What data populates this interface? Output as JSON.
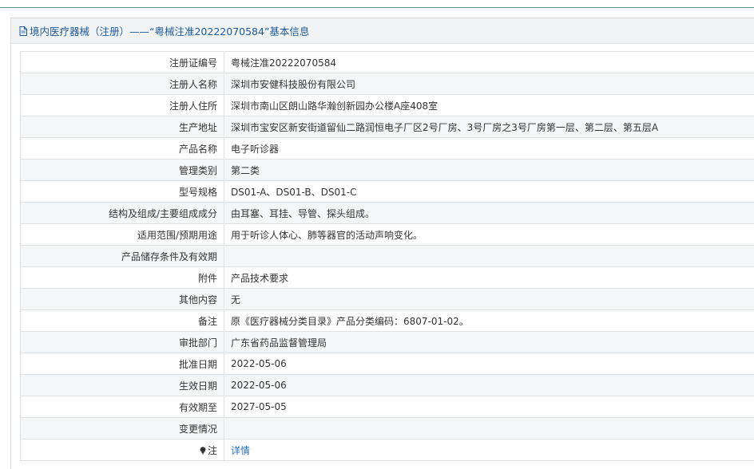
{
  "header": {
    "title": "境内医疗器械（注册）——“粤械注准20222070584”基本信息",
    "icon": "document-icon"
  },
  "rows": [
    {
      "label": "注册证编号",
      "value": "粤械注准20222070584"
    },
    {
      "label": "注册人名称",
      "value": "深圳市安健科技股份有限公司"
    },
    {
      "label": "注册人住所",
      "value": "深圳市南山区朗山路华瀚创新园办公楼A座408室"
    },
    {
      "label": "生产地址",
      "value": "深圳市宝安区新安街道留仙二路润恒电子厂区2号厂房、3号厂房之3号厂房第一层、第二层、第五层A"
    },
    {
      "label": "产品名称",
      "value": "电子听诊器"
    },
    {
      "label": "管理类别",
      "value": "第二类"
    },
    {
      "label": "型号规格",
      "value": "DS01-A、DS01-B、DS01-C"
    },
    {
      "label": "结构及组成/主要组成成分",
      "value": "由耳塞、耳挂、导管、探头组成。"
    },
    {
      "label": "适用范围/预期用途",
      "value": "用于听诊人体心、肺等器官的活动声响变化。"
    },
    {
      "label": "产品储存条件及有效期",
      "value": ""
    },
    {
      "label": "附件",
      "value": "产品技术要求"
    },
    {
      "label": "其他内容",
      "value": "无"
    },
    {
      "label": "备注",
      "value": "原《医疗器械分类目录》产品分类编码：6807-01-02。"
    },
    {
      "label": "审批部门",
      "value": "广东省药品监督管理局"
    },
    {
      "label": "批准日期",
      "value": "2022-05-06"
    },
    {
      "label": "生效日期",
      "value": "2022-05-06"
    },
    {
      "label": "有效期至",
      "value": "2027-05-05"
    },
    {
      "label": "变更情况",
      "value": ""
    }
  ],
  "note_row": {
    "icon": "lightbulb-icon",
    "label": "注",
    "link_text": "详情"
  },
  "colors": {
    "link": "#2a6fb8",
    "header_text": "#1b5a9a",
    "row_alt": "#f5f6f7"
  }
}
